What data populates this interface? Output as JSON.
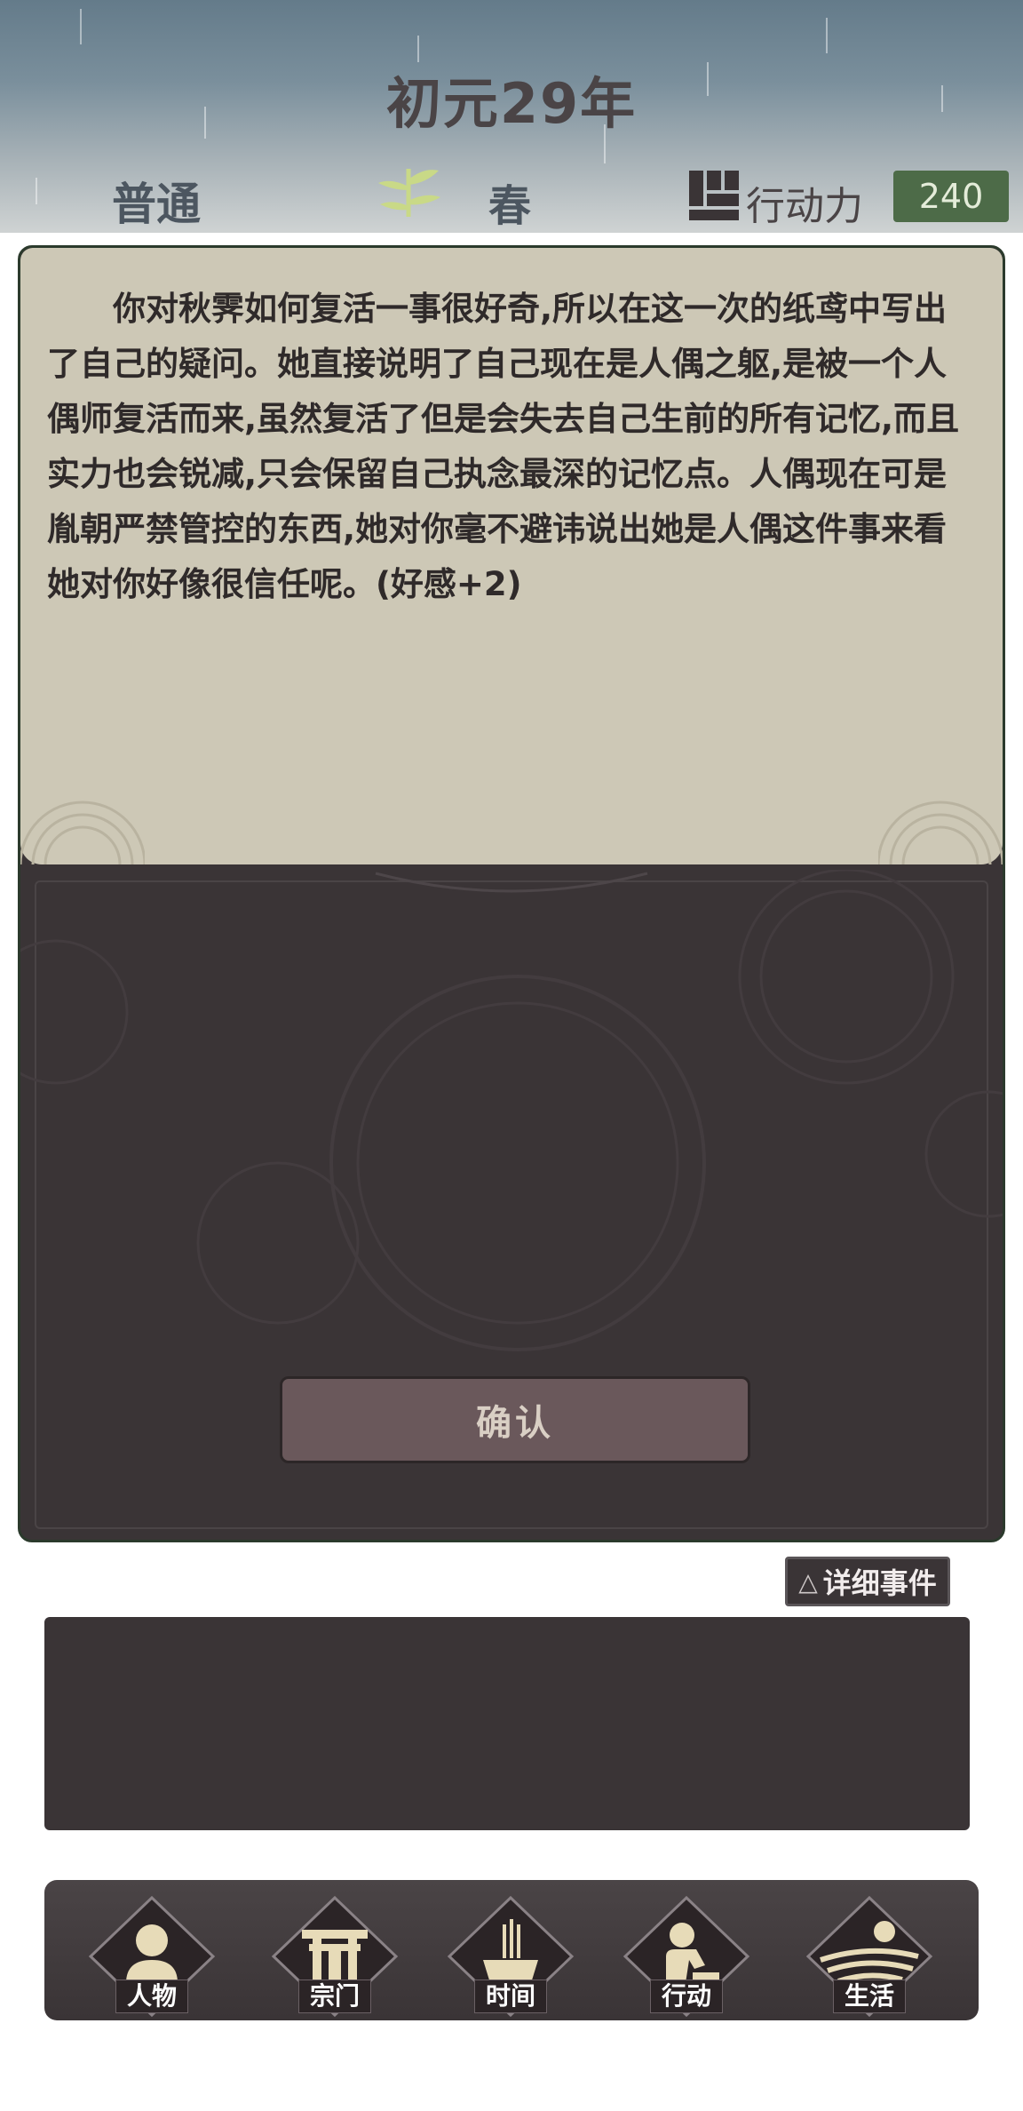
{
  "header": {
    "year": "初元29年",
    "difficulty": "普通",
    "season": "春",
    "action_points_label": "行动力",
    "action_points_value": "240"
  },
  "event": {
    "text": "你对秋霁如何复活一事很好奇,所以在这一次的纸鸢中写出了自己的疑问。她直接说明了自己现在是人偶之躯,是被一个人偶师复活而来,虽然复活了但是会失去自己生前的所有记忆,而且实力也会锐减,只会保留自己执念最深的记忆点。人偶现在可是胤朝严禁管控的东西,她对你毫不避讳说出她是人偶这件事来看她对你好像很信任呢。(好感+2)",
    "confirm_label": "确认"
  },
  "detail_button": {
    "icon": "triangle-icon",
    "label": "详细事件"
  },
  "nav": {
    "items": [
      {
        "label": "人物",
        "icon": "person-icon"
      },
      {
        "label": "宗门",
        "icon": "sect-gate-icon"
      },
      {
        "label": "时间",
        "icon": "incense-icon"
      },
      {
        "label": "行动",
        "icon": "action-icon"
      },
      {
        "label": "生活",
        "icon": "field-icon"
      }
    ]
  },
  "colors": {
    "panel": "#3a3436",
    "parchment": "#cdc8b6",
    "action_points_badge": "#4d6b48",
    "icon_cream": "#e7dbb8"
  }
}
